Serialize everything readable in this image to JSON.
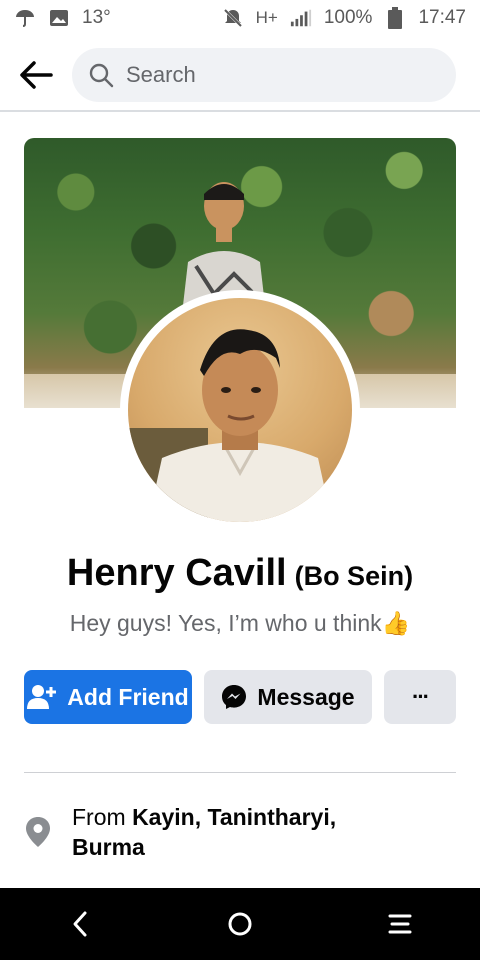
{
  "status_bar": {
    "temperature": "13°",
    "network": "H+",
    "battery": "100%",
    "time": "17:47",
    "icons": [
      "umbrella-icon",
      "image-icon",
      "mute-icon",
      "signal-icon",
      "battery-icon"
    ]
  },
  "topbar": {
    "search_placeholder": "Search"
  },
  "profile": {
    "name": "Henry Cavill",
    "alternate_name": "(Bo Sein)",
    "bio": "Hey guys! Yes, I’m who u think👍"
  },
  "actions": {
    "add_friend": "Add Friend",
    "message": "Message",
    "more": "···"
  },
  "intro": {
    "from_prefix": "From ",
    "location_line1": "Kayin, Tanintharyi,",
    "location_line2": "Burma"
  },
  "colors": {
    "accent": "#1b74e4",
    "secondary_button": "#e4e6eb",
    "muted_text": "#65676b"
  }
}
